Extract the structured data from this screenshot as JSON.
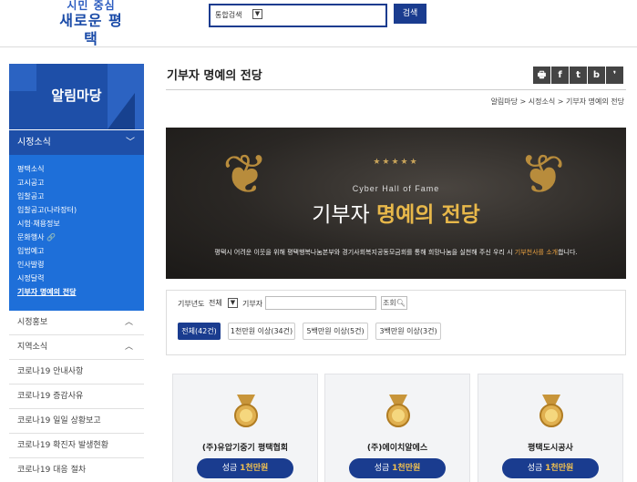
{
  "header": {
    "logo_line1": "시민 중심",
    "logo_line2": "새로운 평택",
    "search_select": "통합검색",
    "search_button": "검색"
  },
  "sidebar": {
    "banner_title": "알림마당",
    "section_title": "시정소식",
    "sub_items": [
      "평택소식",
      "고시공고",
      "입찰공고",
      "입찰공고(나라장터)",
      "시험·채용정보",
      "문화행사 🔗",
      "입법예고",
      "인사발령",
      "시정달력",
      "기부자 명예의 전당"
    ],
    "rows": [
      "시정홍보",
      "지역소식",
      "코로나19 안내사항",
      "코로나19 증감사유",
      "코로나19 일일 상황보고",
      "코로나19 확진자 발생현황",
      "코로나19 대응 절차"
    ]
  },
  "main": {
    "page_title": "기부자 명예의 전당",
    "share_icons": [
      "🖶",
      "f",
      "t",
      "b",
      "❜"
    ],
    "breadcrumb": "알림마당 > 시정소식 > 기부자 명예의 전당",
    "hero": {
      "stars": "★★★★★",
      "subtitle": "Cyber Hall of Fame",
      "title_plain": "기부자",
      "title_gold": "명예의 전당",
      "desc_pre": "평택시 어려운 이웃을 위해 평택행복나눔본부와 경기사회복지공동모금회를 통해 희망나눔을 실천해 주신 우리 시",
      "desc_hl": "기부천사를 소개",
      "desc_post": "합니다."
    },
    "filter": {
      "year_label": "기부년도",
      "year_value": "전체",
      "donor_label": "기부자",
      "search_button": "조회"
    },
    "tabs": [
      "전체(42건)",
      "1천만원 이상(34건)",
      "5백만원 이상(5건)",
      "3백만원 이상(3건)"
    ],
    "cards": [
      {
        "name": "(주)유압기중기 평택협회",
        "amount_prefix": "성금",
        "amount": "1천만원"
      },
      {
        "name": "(주)에이치알에스",
        "amount_prefix": "성금",
        "amount": "1천만원"
      },
      {
        "name": "평택도시공사",
        "amount_prefix": "성금",
        "amount": "1천만원"
      }
    ]
  },
  "colors": {
    "navy": "#1a3c8f",
    "sidebar_blue": "#1e4fa8",
    "sub_blue": "#1e6fd9",
    "gold": "#e8b84a"
  }
}
